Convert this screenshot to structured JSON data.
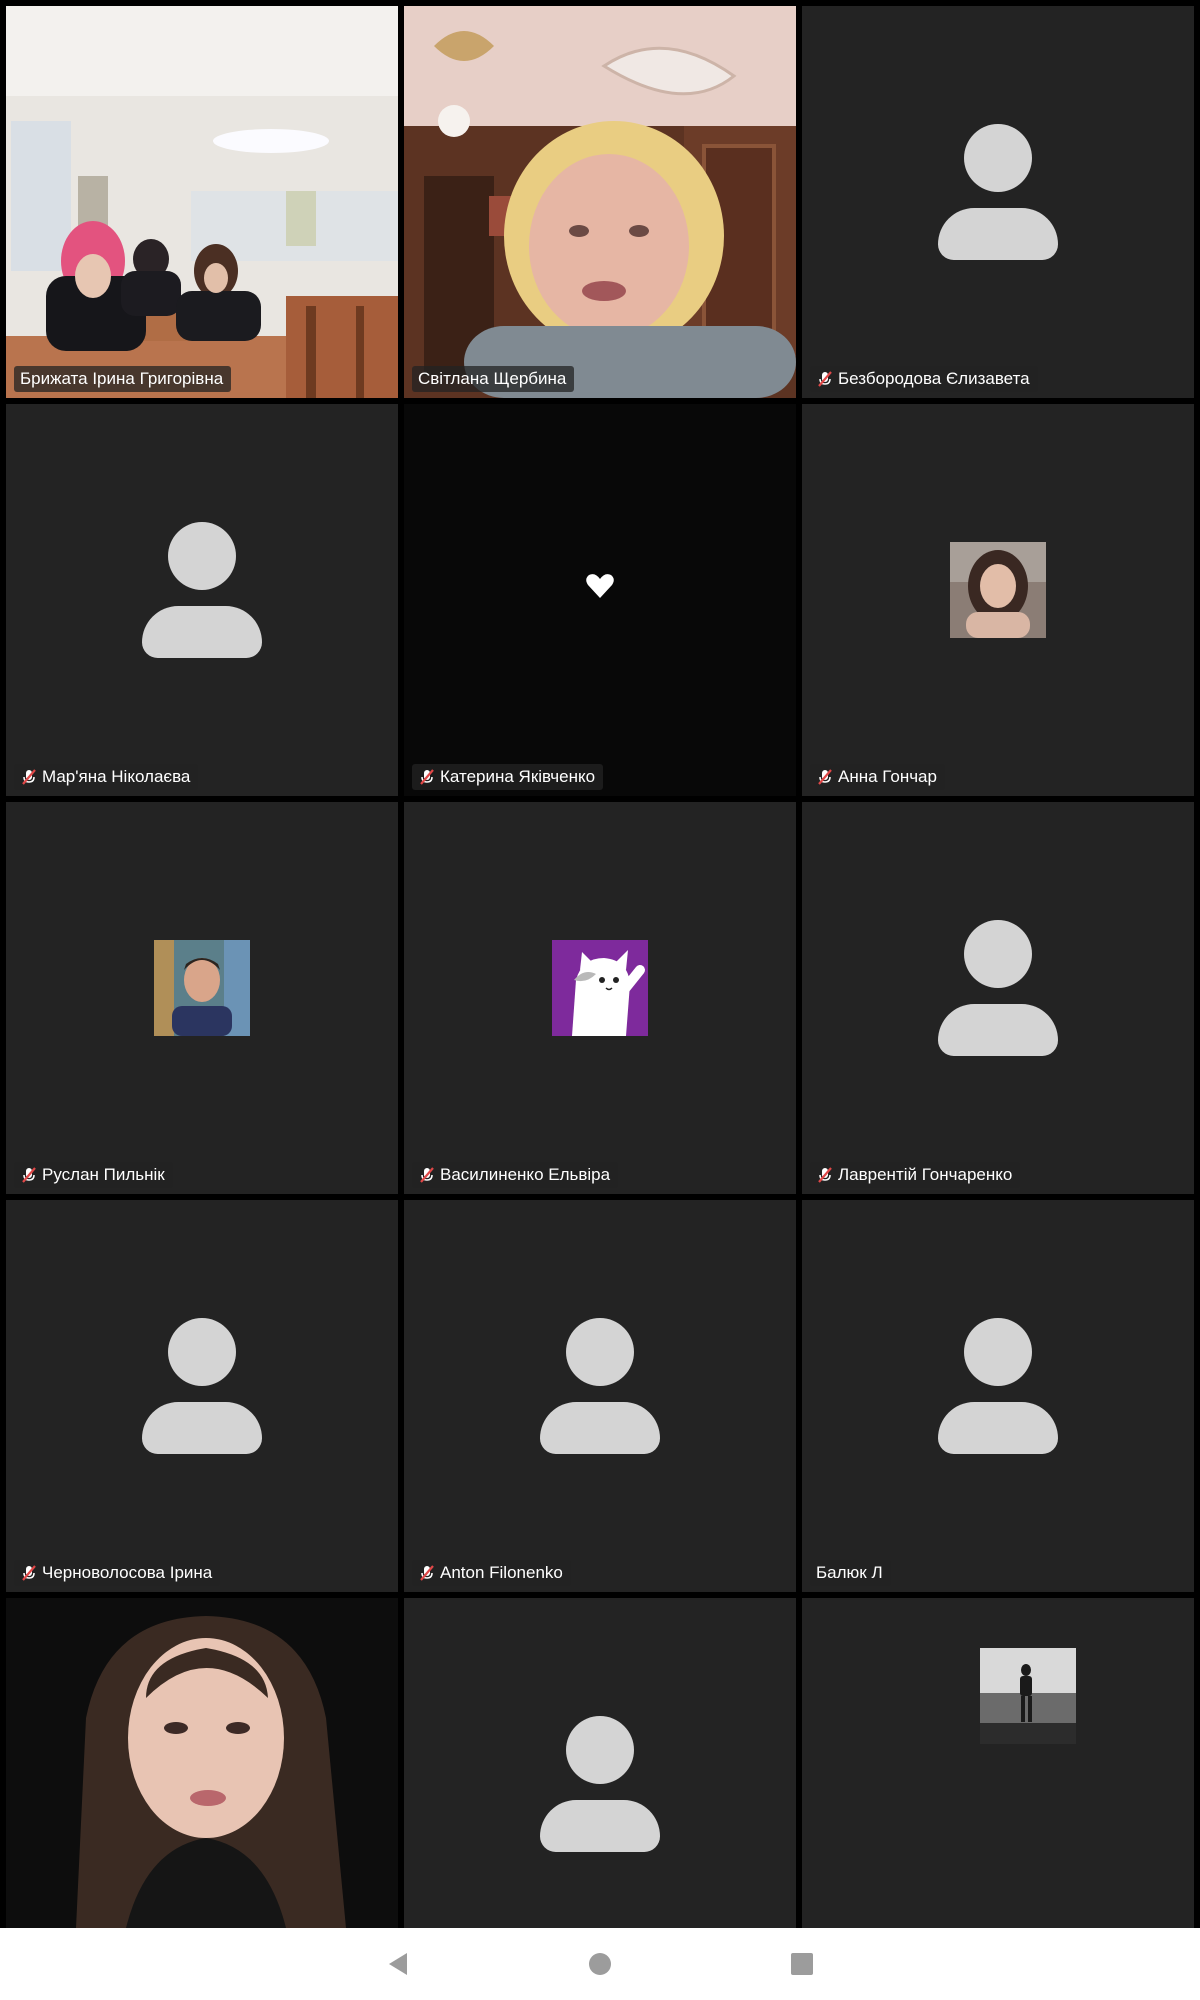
{
  "colors": {
    "tile_bg": "#232323",
    "active_speaker_border": "#23c552",
    "avatar_grey": "#d4d4d4",
    "mic_muted": "#e04848",
    "navbar_bg": "#ffffff"
  },
  "participants": [
    {
      "name": "Брижата Ірина Григорівна",
      "muted": false,
      "media": "video-classroom"
    },
    {
      "name": "Світлана Щербина",
      "muted": false,
      "media": "video-speaker",
      "active": true
    },
    {
      "name": "Безбородова Єлизавета",
      "muted": true,
      "media": "avatar-generic"
    },
    {
      "name": "Мар'яна Ніколаєва",
      "muted": true,
      "media": "avatar-generic"
    },
    {
      "name": "Катерина Яківченко",
      "muted": true,
      "media": "heart-icon"
    },
    {
      "name": "Анна Гончар",
      "muted": true,
      "media": "profile-photo"
    },
    {
      "name": "Руслан Пильнік",
      "muted": true,
      "media": "profile-photo"
    },
    {
      "name": "Василиненко Ельвіра",
      "muted": true,
      "media": "cat-avatar"
    },
    {
      "name": "Лаврентій Гончаренко",
      "muted": true,
      "media": "avatar-generic"
    },
    {
      "name": "Черноволосова Ірина",
      "muted": true,
      "media": "avatar-generic"
    },
    {
      "name": "Anton Filonenko",
      "muted": true,
      "media": "avatar-generic"
    },
    {
      "name": "Балюк Л",
      "muted": false,
      "media": "avatar-generic"
    },
    {
      "name": "",
      "muted": false,
      "media": "video-portrait"
    },
    {
      "name": "",
      "muted": false,
      "media": "avatar-generic"
    },
    {
      "name": "",
      "muted": false,
      "media": "profile-photo"
    }
  ],
  "navbar": {
    "back_icon": "back-triangle-icon",
    "home_icon": "home-circle-icon",
    "recents_icon": "recents-square-icon"
  }
}
